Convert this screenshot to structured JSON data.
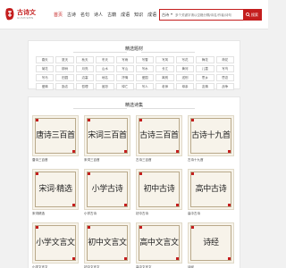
{
  "header": {
    "logo_title": "古诗文",
    "logo_sub": "GUSHIWEN",
    "nav": [
      "首页",
      "古诗",
      "名句",
      "诗人",
      "古籍",
      "成语",
      "知识",
      "成语",
      "查询"
    ],
    "search_category": "古诗",
    "search_placeholder": "多个关键字请以空格分隔/诗名/作者/诗句",
    "search_button": "搜索"
  },
  "colors": {
    "accent": "#c41e1e"
  },
  "tags_section": {
    "title": "精选题材",
    "tags": [
      "春天",
      "夏天",
      "秋天",
      "冬天",
      "写雨",
      "写雪",
      "写风",
      "写花",
      "梅花",
      "荷花",
      "菊花",
      "柳树",
      "月亮",
      "山水",
      "写山",
      "写水",
      "长江",
      "黄河",
      "儿童",
      "写鸟",
      "写马",
      "田园",
      "边塞",
      "地名",
      "抒情",
      "爱国",
      "离别",
      "送别",
      "思乡",
      "思念",
      "爱情",
      "励志",
      "哲理",
      "闺怨",
      "悼亡",
      "写人",
      "老师",
      "母亲",
      "友情",
      "战争"
    ]
  },
  "collections_section": {
    "title": "精选诗集",
    "cards": [
      {
        "cover": "唐诗三百首",
        "label": "唐诗三百首"
      },
      {
        "cover": "宋词三百首",
        "label": "宋词三百首"
      },
      {
        "cover": "古诗三百首",
        "label": "古诗三百首"
      },
      {
        "cover": "古诗十九首",
        "label": "古诗十九首"
      },
      {
        "cover": "宋词·精选",
        "label": "宋词精选"
      },
      {
        "cover": "小学古诗",
        "label": "小学古诗"
      },
      {
        "cover": "初中古诗",
        "label": "初中古诗"
      },
      {
        "cover": "高中古诗",
        "label": "高中古诗"
      },
      {
        "cover": "小学文言文",
        "label": "小学文言文"
      },
      {
        "cover": "初中文言文",
        "label": "初中文言文"
      },
      {
        "cover": "高中文言文",
        "label": "高中文言文"
      },
      {
        "cover": "诗经",
        "label": "诗经"
      }
    ]
  }
}
